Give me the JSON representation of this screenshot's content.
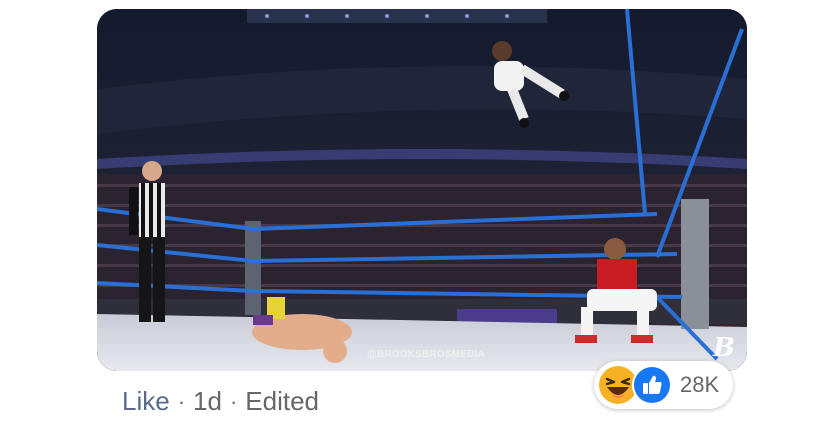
{
  "post": {
    "watermark": "@BROOKSBROSMEDIA",
    "logo_mark": "B"
  },
  "actions": {
    "like_label": "Like",
    "separator": "·",
    "time": "1d",
    "edited_label": "Edited"
  },
  "reactions": {
    "icons": [
      "haha-icon",
      "like-icon"
    ],
    "count": "28K"
  },
  "colors": {
    "like_blue": "#1877f2",
    "haha_yellow": "#f7b125",
    "ring_rope": "#2a6fd6"
  }
}
